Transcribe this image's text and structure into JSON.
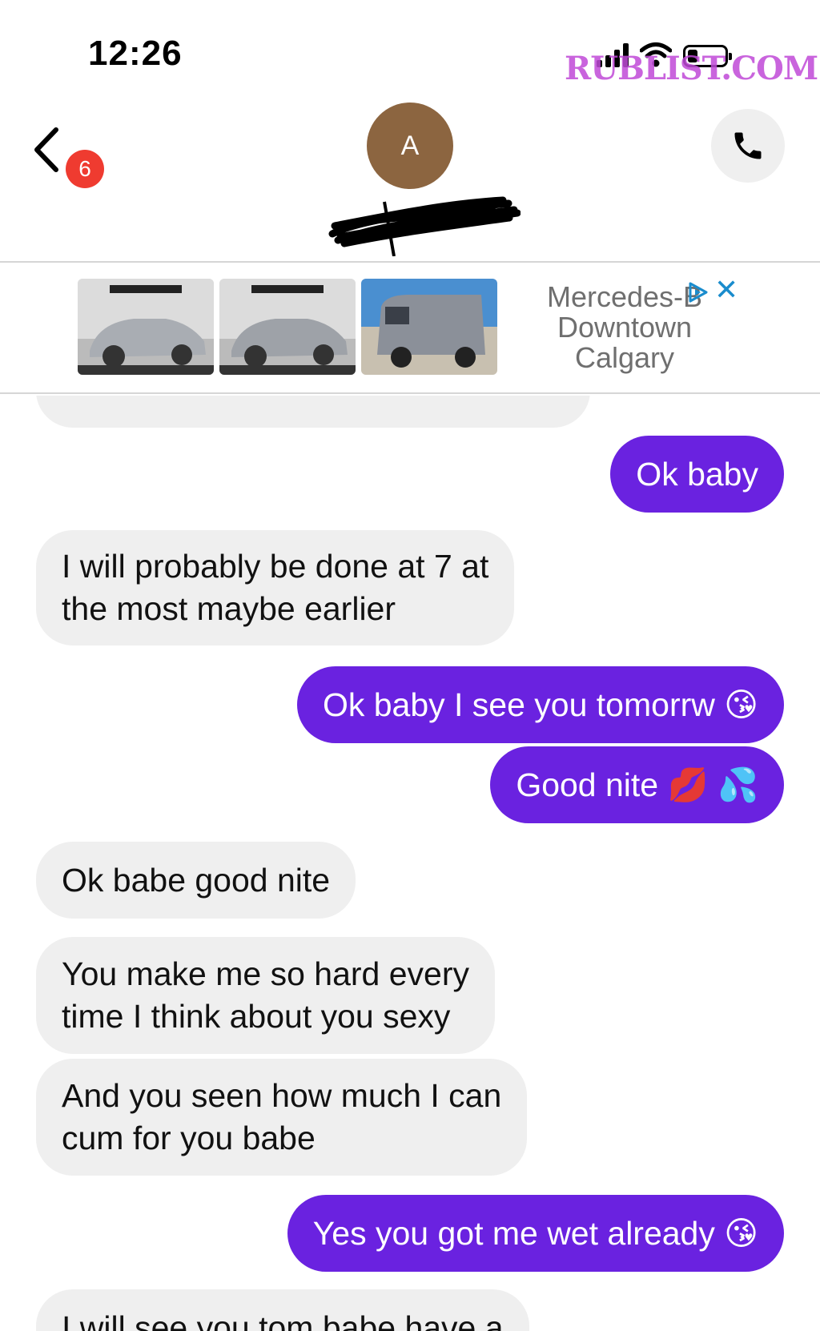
{
  "status_bar": {
    "time": "12:26",
    "watermark": "RUBLIST.COM",
    "signal_icon": "cellular-signal-icon",
    "wifi_icon": "wifi-icon",
    "battery_icon": "battery-icon"
  },
  "header": {
    "back_icon": "chevron-left-icon",
    "unread_count": "6",
    "avatar_initial": "A",
    "call_icon": "phone-icon"
  },
  "ad": {
    "title_lines": [
      "Mercedes-B",
      "Downtown",
      "Calgary"
    ],
    "adchoices_icon": "adchoices-icon",
    "close_label": "✕"
  },
  "messages": [
    {
      "side": "out",
      "lines": [
        "Ok baby"
      ]
    },
    {
      "side": "in",
      "lines": [
        "I will probably be done at 7 at",
        "the most maybe earlier"
      ]
    },
    {
      "side": "out",
      "lines": [
        "Ok baby I see you tomorrw 😘"
      ]
    },
    {
      "side": "out",
      "lines": [
        "Good nite 💋 💦"
      ]
    },
    {
      "side": "in",
      "lines": [
        "Ok babe good nite"
      ]
    },
    {
      "side": "in",
      "lines": [
        "You make me so hard every",
        "time I think about you sexy"
      ]
    },
    {
      "side": "in",
      "lines": [
        "And you seen how much I can",
        "cum for you babe"
      ]
    },
    {
      "side": "out",
      "lines": [
        "Yes you got me wet already 😘"
      ]
    },
    {
      "side": "in",
      "lines": [
        "I will see you tom babe have a"
      ]
    }
  ],
  "colors": {
    "outgoing_bubble": "#6a22e0",
    "incoming_bubble": "#efefef",
    "badge": "#ef3b30",
    "avatar": "#8c6540"
  }
}
